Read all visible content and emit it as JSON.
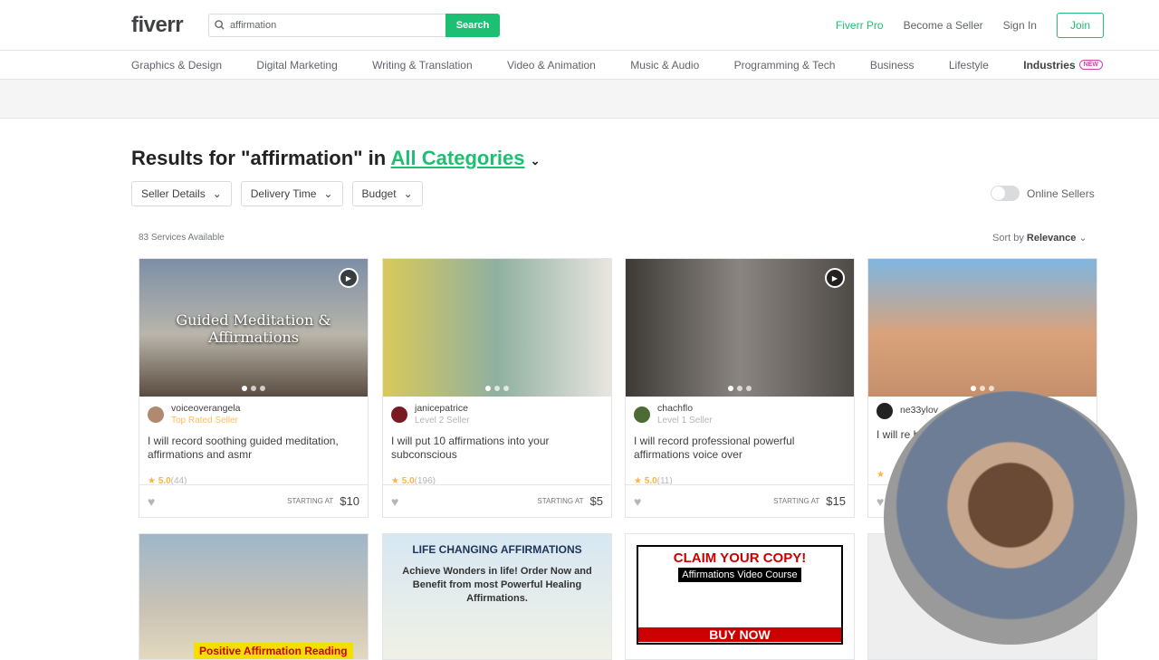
{
  "header": {
    "logo": "fiverr",
    "search_value": "affirmation",
    "search_button": "Search",
    "links": [
      "Fiverr Pro",
      "Become a Seller",
      "Sign In"
    ],
    "join": "Join"
  },
  "categories": [
    "Graphics & Design",
    "Digital Marketing",
    "Writing & Translation",
    "Video & Animation",
    "Music & Audio",
    "Programming & Tech",
    "Business",
    "Lifestyle"
  ],
  "industries": {
    "label": "Industries",
    "badge": "NEW"
  },
  "results": {
    "prefix": "Results for \"affirmation\" in",
    "category": "All Categories"
  },
  "filters": [
    "Seller Details",
    "Delivery Time",
    "Budget"
  ],
  "online_sellers": "Online Sellers",
  "count": "83 Services Available",
  "sort": {
    "label": "Sort by",
    "value": "Relevance"
  },
  "gigs": [
    {
      "seller": "voiceoverangela",
      "level": "Top Rated Seller",
      "title": "I will record soothing guided meditation, affirmations and asmr",
      "rating": "5.0",
      "reviews": "(44)",
      "starting": "STARTING AT",
      "price": "$10",
      "image_text": "Guided Meditation & Affirmations",
      "video": true
    },
    {
      "seller": "janicepatrice",
      "level": "Level 2 Seller",
      "title": "I will put 10 affirmations into your subconscious",
      "rating": "5.0",
      "reviews": "(196)",
      "starting": "STARTING AT",
      "price": "$5",
      "image_text": "",
      "video": false
    },
    {
      "seller": "chachflo",
      "level": "Level 1 Seller",
      "title": "I will record professional powerful affirmations voice over",
      "rating": "5.0",
      "reviews": "(11)",
      "starting": "STARTING AT",
      "price": "$15",
      "image_text": "",
      "video": true
    },
    {
      "seller": "ne33ylov",
      "level": "",
      "title": "I will re hypn",
      "rating": "",
      "reviews": "",
      "starting": "",
      "price": "",
      "image_text": "",
      "video": false
    }
  ],
  "row2": [
    {
      "image_text": "Positive Affirmation Reading"
    },
    {
      "image_text": "LIFE CHANGING AFFIRMATIONS",
      "sub": "Achieve Wonders in life! Order Now and Benefit from most Powerful Healing Affirmations."
    },
    {
      "image_text": "CLAIM YOUR COPY!",
      "sub": "Affirmations Video Course",
      "cta": "BUY NOW"
    },
    {
      "image_text": ""
    }
  ],
  "colors": {
    "brand": "#1dbf73",
    "star": "#ffb33e",
    "top_rated": "#ffbe5b"
  }
}
